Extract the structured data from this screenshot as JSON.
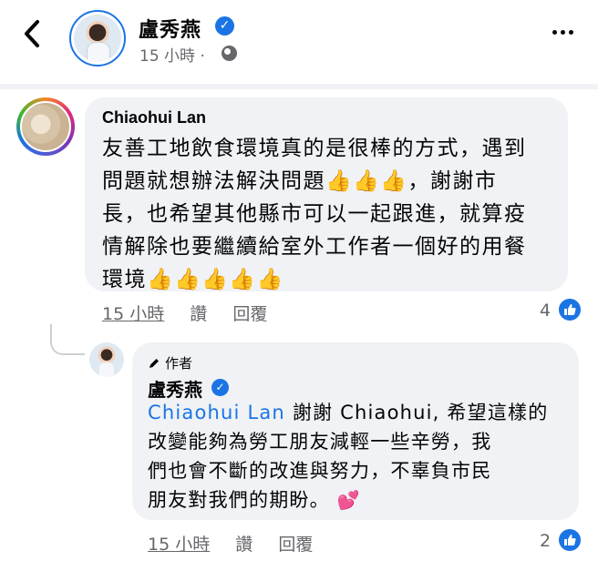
{
  "header": {
    "back_icon": "chevron-left-icon",
    "poster_name": "盧秀燕",
    "post_time": "15 小時 ·",
    "privacy_icon": "globe-icon",
    "more_icon": "more-horizontal-icon"
  },
  "comment": {
    "author": "Chiaohui Lan",
    "lines": [
      "友善工地飲食環境真的是很棒的方式，遇到",
      "問題就想辦法解決問題👍👍👍，謝謝市",
      "長，也希望其他縣市可以一起跟進，就算疫",
      "情解除也要繼續給室外工作者一個好的用餐",
      "環境👍👍👍👍👍"
    ],
    "time": "15 小時",
    "like_label": "讚",
    "reply_label": "回覆",
    "reaction_count": "4"
  },
  "reply": {
    "badge": "作者",
    "author": "盧秀燕",
    "mention": "Chiaohui Lan",
    "line1_rest": " 謝謝 Chiaohui, 希望這樣的",
    "lines": [
      "改變能夠為勞工朋友減輕一些辛勞，我",
      "們也會不斷的改進與努力，不辜負市民",
      "朋友對我們的期盼。"
    ],
    "hearts": "💕",
    "time": "15 小時",
    "like_label": "讚",
    "reply_label": "回覆",
    "reaction_count": "2"
  },
  "colors": {
    "accent": "#1b74e4",
    "bubble": "#f0f2f5",
    "meta": "#65676b"
  }
}
